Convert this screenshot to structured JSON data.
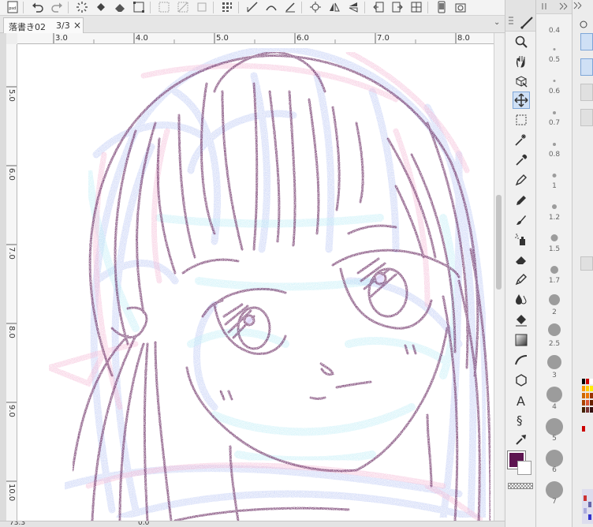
{
  "document_tab": {
    "name": "落書き02",
    "page": "3/3",
    "close": "×"
  },
  "ruler_top": [
    "3.0",
    "4.0",
    "5.0",
    "6.0",
    "7.0",
    "8.0"
  ],
  "ruler_left": [
    "5.0",
    "6.0",
    "7.0",
    "8.0",
    "9.0",
    "10.0"
  ],
  "status": {
    "zoom": "73.3",
    "angle": "0.0"
  },
  "colors": {
    "main": "#5c1450",
    "sub": "#ffffff",
    "accent": "#7ea6d8"
  },
  "brush_sizes": [
    "0.4",
    "0.5",
    "0.6",
    "0.7",
    "0.8",
    "1",
    "1.2",
    "1.5",
    "1.7",
    "2",
    "2.5",
    "3",
    "4",
    "5",
    "6",
    "7"
  ],
  "toolbar_icons": [
    "psd-icon",
    "undo-icon",
    "redo-icon",
    "loading-icon",
    "fill-icon",
    "transform-icon",
    "clear-icon",
    "fill-select-icon",
    "grid-icon",
    "curve-icon",
    "ruler-icon",
    "snap-icon",
    "flip-icon",
    "page-prev-icon",
    "page-next-icon",
    "layout-icon",
    "device-icon",
    "camera-icon"
  ],
  "tools": [
    "zoom-tool-icon",
    "hand-tool-icon",
    "object-tool-icon",
    "move-tool-icon",
    "selection-tool-icon",
    "magic-wand-icon",
    "eyedropper-icon",
    "pen-icon",
    "pencil-icon",
    "brush-icon",
    "airbrush-icon",
    "eraser-icon",
    "blend-icon",
    "fill-icon",
    "gradient-icon",
    "figure-icon",
    "text-icon",
    "ruler-tool-icon",
    "correction-icon"
  ]
}
